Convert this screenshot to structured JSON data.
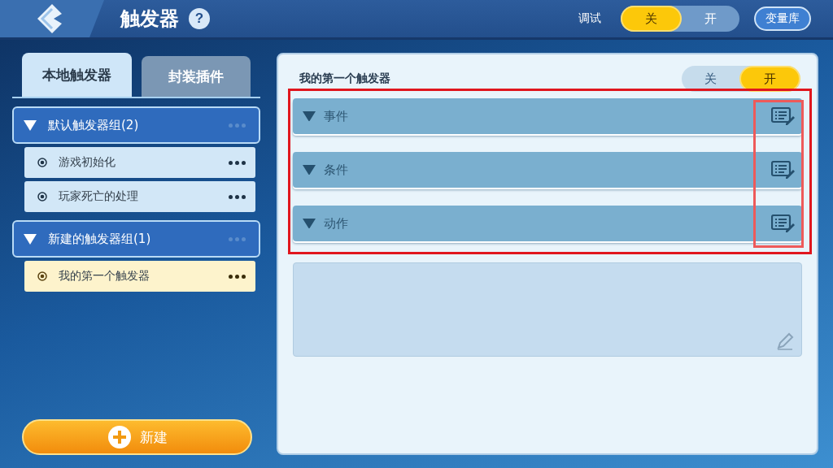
{
  "header": {
    "title": "触发器",
    "help": "?",
    "debug_label": "调试",
    "debug_toggle": [
      {
        "label": "关",
        "selected": true
      },
      {
        "label": "开",
        "selected": false
      }
    ],
    "variables_button": "变量库"
  },
  "sidebar": {
    "tabs": [
      {
        "label": "本地触发器",
        "selected": true
      },
      {
        "label": "封装插件",
        "selected": false
      }
    ],
    "groups": [
      {
        "name": "默认触发器组(2)",
        "expanded": true,
        "children": [
          {
            "name": "游戏初始化",
            "selected": false
          },
          {
            "name": "玩家死亡的处理",
            "selected": false
          }
        ]
      },
      {
        "name": "新建的触发器组(1)",
        "expanded": true,
        "children": [
          {
            "name": "我的第一个触发器",
            "selected": true
          }
        ]
      }
    ],
    "new_button": "新建"
  },
  "editor": {
    "title": "我的第一个触发器",
    "enabled_toggle": [
      {
        "label": "关",
        "selected": false
      },
      {
        "label": "开",
        "selected": true
      }
    ],
    "sections": [
      {
        "label": "事件"
      },
      {
        "label": "条件"
      },
      {
        "label": "动作"
      }
    ]
  }
}
